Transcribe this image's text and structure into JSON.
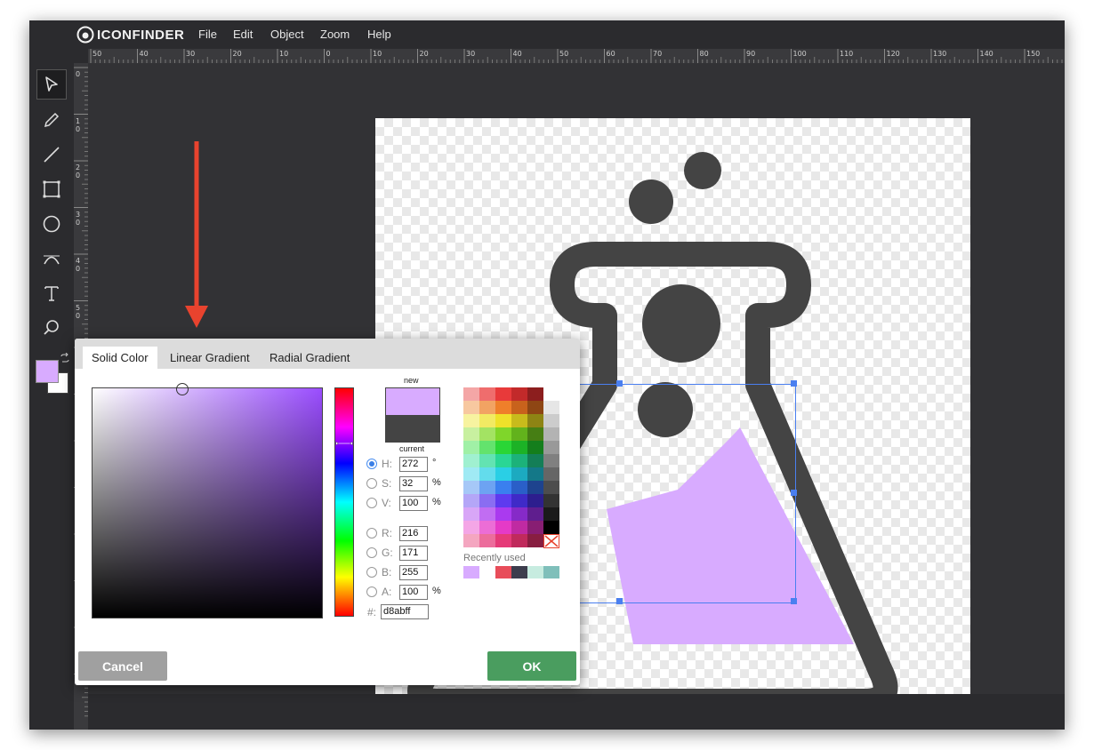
{
  "app": {
    "logo_text": "ICONFINDER",
    "menu": [
      "File",
      "Edit",
      "Object",
      "Zoom",
      "Help"
    ]
  },
  "ruler": {
    "horizontal_labels": [
      "50",
      "40",
      "30",
      "20",
      "10",
      "0",
      "10",
      "20",
      "30",
      "40",
      "50",
      "60",
      "70",
      "80",
      "90",
      "100",
      "110",
      "120",
      "130",
      "140",
      "150"
    ],
    "vertical_labels": [
      "0",
      "10",
      "20",
      "30",
      "40",
      "50"
    ]
  },
  "tools": [
    "select-icon",
    "pencil-icon",
    "line-icon",
    "rectangle-icon",
    "ellipse-icon",
    "path-icon",
    "text-icon",
    "zoom-icon"
  ],
  "colors": {
    "accent": "#3a7fe6",
    "fill_color": "#d8abff",
    "ok_green": "#4a9d5f",
    "cancel_gray": "#a0a0a0",
    "arrow_red": "#e8432e",
    "flask_gray": "#444444"
  },
  "dialog": {
    "tabs": [
      "Solid Color",
      "Linear Gradient",
      "Radial Gradient"
    ],
    "active_tab": "Solid Color",
    "preview_new_label": "new",
    "preview_current_label": "current",
    "fields": {
      "h": {
        "label": "H:",
        "value": "272",
        "unit": "°"
      },
      "s": {
        "label": "S:",
        "value": "32",
        "unit": "%"
      },
      "v": {
        "label": "V:",
        "value": "100",
        "unit": "%"
      },
      "r": {
        "label": "R:",
        "value": "216"
      },
      "g": {
        "label": "G:",
        "value": "171"
      },
      "b": {
        "label": "B:",
        "value": "255"
      },
      "a": {
        "label": "A:",
        "value": "100",
        "unit": "%"
      },
      "hex": {
        "label": "#:",
        "value": "d8abff"
      }
    },
    "selected_mode": "H",
    "recently_used_label": "Recently used",
    "recent_colors": [
      "#d8abff",
      "#ffffff",
      "#e84d5a",
      "#3d3d4d",
      "#c7ece0",
      "#7fbfba"
    ],
    "cancel_label": "Cancel",
    "ok_label": "OK"
  }
}
